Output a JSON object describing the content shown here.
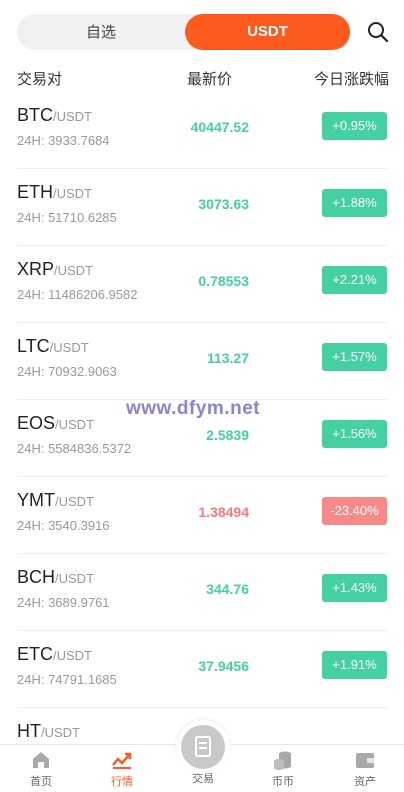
{
  "tabs": {
    "favorites": "自选",
    "usdt": "USDT"
  },
  "columns": {
    "pair": "交易对",
    "price": "最新价",
    "change": "今日涨跌幅"
  },
  "colors": {
    "accent": "#fd5a1d",
    "up": "#45d0a4",
    "down": "#f98888",
    "up_text": "#45cfa3",
    "down_text": "#f5797c"
  },
  "rows": [
    {
      "base": "BTC",
      "quote": "/USDT",
      "vol": "24H: 3933.7684",
      "price": "40447.52",
      "change": "+0.95%",
      "dir": "up"
    },
    {
      "base": "ETH",
      "quote": "/USDT",
      "vol": "24H: 51710.6285",
      "price": "3073.63",
      "change": "+1.88%",
      "dir": "up"
    },
    {
      "base": "XRP",
      "quote": "/USDT",
      "vol": "24H: 11486206.9582",
      "price": "0.78553",
      "change": "+2.21%",
      "dir": "up"
    },
    {
      "base": "LTC",
      "quote": "/USDT",
      "vol": "24H: 70932.9063",
      "price": "113.27",
      "change": "+1.57%",
      "dir": "up"
    },
    {
      "base": "EOS",
      "quote": "/USDT",
      "vol": "24H: 5584836.5372",
      "price": "2.5839",
      "change": "+1.56%",
      "dir": "up"
    },
    {
      "base": "YMT",
      "quote": "/USDT",
      "vol": "24H: 3540.3916",
      "price": "1.38494",
      "change": "-23.40%",
      "dir": "down"
    },
    {
      "base": "BCH",
      "quote": "/USDT",
      "vol": "24H: 3689.9761",
      "price": "344.76",
      "change": "+1.43%",
      "dir": "up"
    },
    {
      "base": "ETC",
      "quote": "/USDT",
      "vol": "24H: 74791.1685",
      "price": "37.9456",
      "change": "+1.91%",
      "dir": "up"
    },
    {
      "base": "HT",
      "quote": "/USDT",
      "vol": "",
      "price": "",
      "change": "",
      "dir": "up"
    }
  ],
  "watermark": "www.dfym.net",
  "nav": [
    {
      "label": "首页",
      "icon": "home-icon",
      "active": false
    },
    {
      "label": "行情",
      "icon": "market-chart-icon",
      "active": true
    },
    {
      "label": "交易",
      "icon": "trade-icon",
      "active": false
    },
    {
      "label": "币币",
      "icon": "coins-icon",
      "active": false
    },
    {
      "label": "资产",
      "icon": "wallet-icon",
      "active": false
    }
  ]
}
